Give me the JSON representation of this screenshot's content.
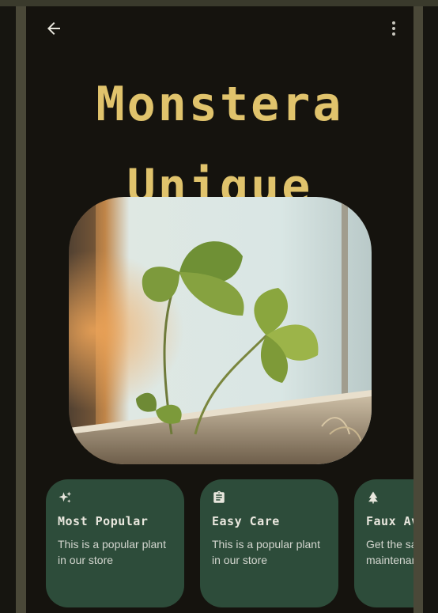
{
  "app": {
    "title_line1": "Monstera",
    "title_line2": "Unique"
  },
  "toolbar": {
    "back_icon": "arrow-back-icon",
    "menu_icon": "more-vert-icon"
  },
  "photo": {
    "subject": "plant-photo"
  },
  "cards": [
    {
      "icon": "sparkles-icon",
      "title": "Most Popular",
      "body": "This is a popular plant in our store"
    },
    {
      "icon": "clipboard-icon",
      "title": "Easy Care",
      "body": "This is a popular plant in our store"
    },
    {
      "icon": "tree-icon",
      "title": "Faux Av",
      "body": "Get the sa without th maintenan"
    }
  ],
  "colors": {
    "accent": "#e0c36c",
    "card": "#2d4c3a",
    "background": "#15130e",
    "rail": "#4a4838"
  }
}
